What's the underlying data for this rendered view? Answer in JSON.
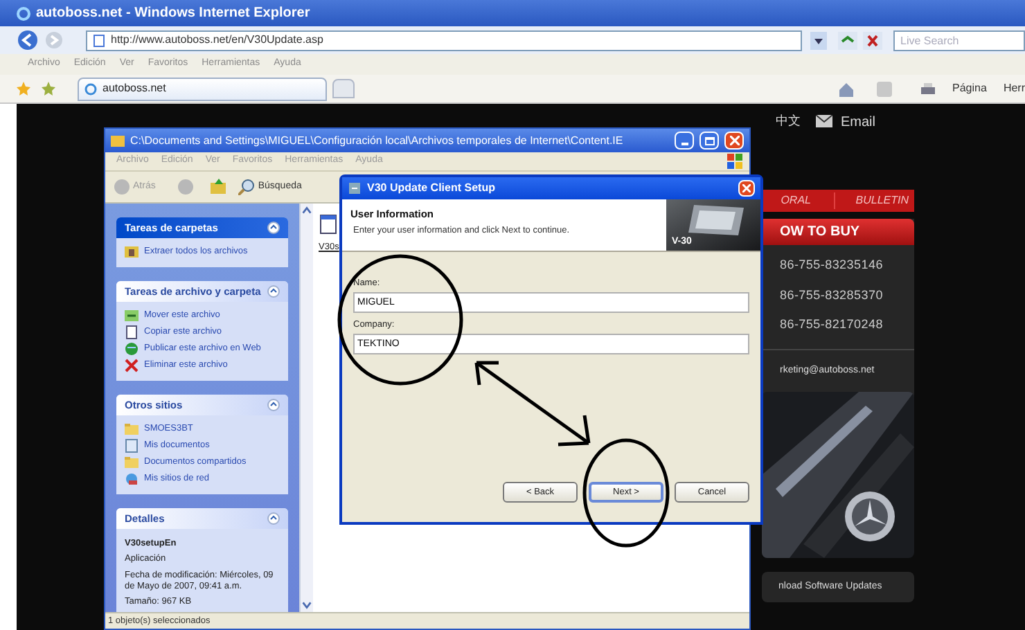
{
  "browser": {
    "title": "autoboss.net - Windows Internet Explorer",
    "address": "http://www.autoboss.net/en/V30Update.asp",
    "search_placeholder": "Live Search",
    "menu": [
      "Archivo",
      "Edición",
      "Ver",
      "Favoritos",
      "Herramientas",
      "Ayuda"
    ],
    "tab": "autoboss.net",
    "toolbar_page": "Página",
    "toolbar_tools": "Herr"
  },
  "website": {
    "lang": "中文",
    "email": "Email",
    "nav": [
      "ORAL",
      "BULLETIN"
    ],
    "how_to_buy": "OW TO BUY",
    "phones": [
      "86-755-83235146",
      "86-755-83285370",
      "86-755-82170248"
    ],
    "contact_email": "rketing@autoboss.net",
    "download": "nload Software Updates"
  },
  "explorer": {
    "title": "C:\\Documents and Settings\\MIGUEL\\Configuración local\\Archivos temporales de Internet\\Content.IE",
    "menu": [
      "Archivo",
      "Edición",
      "Ver",
      "Favoritos",
      "Herramientas",
      "Ayuda"
    ],
    "back": "Atrás",
    "search": "Búsqueda",
    "file_label": "V30s",
    "panels": [
      {
        "title": "Tareas de carpetas",
        "highlighted": true,
        "items": [
          {
            "label": "Extraer todos los archivos",
            "kind": "extract"
          }
        ]
      },
      {
        "title": "Tareas de archivo y carpeta",
        "highlighted": false,
        "items": [
          {
            "label": "Mover este archivo",
            "kind": "move"
          },
          {
            "label": "Copiar este archivo",
            "kind": "copy"
          },
          {
            "label": "Publicar este archivo en Web",
            "kind": "web"
          },
          {
            "label": "Eliminar este archivo",
            "kind": "delete"
          }
        ]
      },
      {
        "title": "Otros sitios",
        "highlighted": false,
        "items": [
          {
            "label": "SMOES3BT",
            "kind": "folder"
          },
          {
            "label": "Mis documentos",
            "kind": "docs"
          },
          {
            "label": "Documentos compartidos",
            "kind": "folder"
          },
          {
            "label": "Mis sitios de red",
            "kind": "network"
          }
        ]
      }
    ],
    "details": {
      "title": "Detalles",
      "name": "V30setupEn",
      "type": "Aplicación",
      "modified": "Fecha de modificación: Miércoles, 09 de Mayo de 2007, 09:41 a.m.",
      "size": "Tamaño: 967 KB"
    },
    "status": "1 objeto(s) seleccionados"
  },
  "dialog": {
    "title": "V30 Update Client Setup",
    "heading": "User Information",
    "subheading": "Enter your user information and click Next to continue.",
    "banner_label": "V-30",
    "fields": [
      {
        "label": "Name:",
        "value": "MIGUEL"
      },
      {
        "label": "Company:",
        "value": "TEKTINO"
      }
    ],
    "buttons": [
      {
        "label": "< Back",
        "selected": false
      },
      {
        "label": "Next >",
        "selected": true
      },
      {
        "label": "Cancel",
        "selected": false
      }
    ]
  }
}
